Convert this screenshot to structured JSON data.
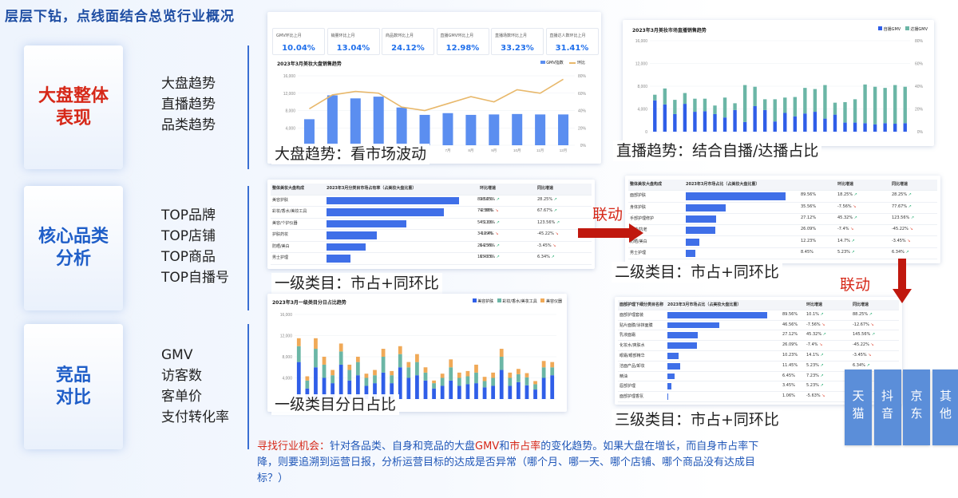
{
  "title": "层层下钻，点线面结合总览行业概况",
  "sections": [
    {
      "name": "大盘整体\n表现",
      "color": "#d62818",
      "items": [
        "大盘趋势",
        "直播趋势",
        "品类趋势"
      ]
    },
    {
      "name": "核心品类\n分析",
      "color": "#1f5ec8",
      "items": [
        "TOP品牌",
        "TOP店铺",
        "TOP商品",
        "TOP自播号"
      ]
    },
    {
      "name": "竞品\n对比",
      "color": "#1f5ec8",
      "items": [
        "GMV",
        "访客数",
        "客单价",
        "支付转化率"
      ]
    }
  ],
  "kpis": [
    {
      "label": "GMV环比上月",
      "value": "10.04%"
    },
    {
      "label": "销量环比上月",
      "value": "13.04%"
    },
    {
      "label": "商品数环比上月",
      "value": "24.12%"
    },
    {
      "label": "直播GMV环比上月",
      "value": "12.98%"
    },
    {
      "label": "直播场数环比上月",
      "value": "33.23%"
    },
    {
      "label": "直播达人数环比上月",
      "value": "31.41%"
    }
  ],
  "panel1": {
    "title": "2023年3月美妆大盘销售趋势",
    "legend": [
      "GMV指数",
      "环比"
    ],
    "caption": "大盘趋势：看市场波动",
    "chart_data": {
      "type": "bar",
      "categories": [
        "1月",
        "2月",
        "3月",
        "4月",
        "5月",
        "6月",
        "7月",
        "8月",
        "9月",
        "10月",
        "11月",
        "12月"
      ],
      "series": [
        {
          "name": "GMV指数",
          "values": [
            6000,
            11500,
            10800,
            11200,
            8700,
            7000,
            7400,
            7000,
            7100,
            7200,
            7100,
            7100
          ]
        },
        {
          "name": "环比",
          "values": [
            42,
            58,
            62,
            60,
            44,
            40,
            48,
            56,
            50,
            64,
            60,
            76
          ]
        }
      ],
      "ylim": [
        0,
        16000
      ],
      "y2lim": [
        0,
        80
      ],
      "yticks": [
        "16,000",
        "12,000",
        "8,000",
        "4,000",
        "0"
      ],
      "y2ticks": [
        "80%",
        "60%",
        "40%",
        "20%",
        "0%"
      ]
    }
  },
  "panel2": {
    "title": "2023年3月美妆市场直播销售趋势",
    "legend": [
      "自播GMV",
      "达播GMV"
    ],
    "caption": "直播趋势：结合自播/达播占比",
    "chart_data": {
      "type": "bar",
      "series": [
        {
          "name": "自播GMV",
          "values": [
            5500,
            4800,
            3100,
            4900,
            3500,
            3600,
            3100,
            2500,
            3800,
            1700,
            4500,
            3800,
            1800,
            3300,
            2700,
            3200,
            3500,
            2300,
            3000,
            1600,
            1600,
            1500,
            1300,
            1500,
            1400,
            1500
          ]
        },
        {
          "name": "达播GMV",
          "values": [
            1000,
            2800,
            2500,
            1900,
            2300,
            2200,
            1500,
            3500,
            1200,
            6500,
            3400,
            1900,
            3900,
            2700,
            3400,
            4500,
            4000,
            5900,
            2100,
            3600,
            4100,
            6800,
            6600,
            6200,
            6800,
            6400
          ]
        }
      ],
      "ylim": [
        0,
        16000
      ],
      "yticks": [
        "16,000",
        "12,000",
        "8,000",
        "4,000",
        "0"
      ],
      "y2ticks": [
        "80%",
        "60%",
        "40%",
        "20%",
        "0%"
      ]
    }
  },
  "table1": {
    "headers": [
      "整体美妆大盘构成",
      "2023年3月分类目市场占有率（占美妆大盘比重）",
      "环比增速",
      "同比增速"
    ],
    "caption": "一级类目：市占+同环比",
    "rows": [
      {
        "name": "美容护肤",
        "share": "89.56%",
        "pct": 89.56,
        "mom": "28.25%",
        "mom_up": true,
        "yoy": "28.25%",
        "yoy_up": true
      },
      {
        "name": "彩妆/香水/美妆工具",
        "share": "79.56%",
        "pct": 79.56,
        "mom": "-2.56%",
        "mom_up": false,
        "yoy": "67.67%",
        "yoy_up": true
      },
      {
        "name": "美容/个护仪器",
        "share": "54.12%",
        "pct": 54.12,
        "mom": "45.32%",
        "mom_up": true,
        "yoy": "123.56%",
        "yoy_up": true
      },
      {
        "name": "护肤药妆",
        "share": "34.09%",
        "pct": 34.09,
        "mom": "-12.4%",
        "mom_up": false,
        "yoy": "-45.22%",
        "yoy_up": false
      },
      {
        "name": "防晒/美白",
        "share": "26.23%",
        "pct": 26.23,
        "mom": "14.56%",
        "mom_up": true,
        "yoy": "-3.45%",
        "yoy_up": false
      },
      {
        "name": "男士护理",
        "share": "16.45%",
        "pct": 16.45,
        "mom": "15.23%",
        "mom_up": true,
        "yoy": "6.34%",
        "yoy_up": true
      }
    ]
  },
  "table2": {
    "headers": [
      "整体美妆大盘构成",
      "2023年3月市场占比（占美妆大盘比重）",
      "环比增速",
      "同比增速"
    ],
    "caption": "二级类目：市占+同环比",
    "rows": [
      {
        "name": "面部护肤",
        "share": "89.56%",
        "pct": 89.56,
        "mom": "18.25%",
        "mom_up": true,
        "yoy": "28.25%",
        "yoy_up": true
      },
      {
        "name": "身体护肤",
        "share": "35.56%",
        "pct": 35.56,
        "mom": "-7.56%",
        "mom_up": false,
        "yoy": "77.67%",
        "yoy_up": true
      },
      {
        "name": "手部护理修护",
        "share": "27.12%",
        "pct": 27.12,
        "mom": "45.32%",
        "mom_up": true,
        "yoy": "123.56%",
        "yoy_up": true
      },
      {
        "name": "抗敏/抗老",
        "share": "26.09%",
        "pct": 26.09,
        "mom": "-7.4%",
        "mom_up": false,
        "yoy": "-45.22%",
        "yoy_up": false
      },
      {
        "name": "防晒/美白",
        "share": "12.23%",
        "pct": 12.23,
        "mom": "14.7%",
        "mom_up": true,
        "yoy": "-3.45%",
        "yoy_up": false
      },
      {
        "name": "男士护理",
        "share": "8.45%",
        "pct": 8.45,
        "mom": "5.23%",
        "mom_up": true,
        "yoy": "6.34%",
        "yoy_up": true
      }
    ]
  },
  "table3": {
    "headers": [
      "面部护理下细分类目名称",
      "2023年3月市场占比（占美妆大盘比重）",
      "环比增速",
      "同比增速"
    ],
    "caption": "三级类目：市占+同环比",
    "rows": [
      {
        "name": "面部护理套装",
        "share": "89.56%",
        "pct": 89.56,
        "mom": "10.1%",
        "mom_up": true,
        "yoy": "88.25%",
        "yoy_up": true
      },
      {
        "name": "贴片面膜/涂抹面膜",
        "share": "46.56%",
        "pct": 46.56,
        "mom": "-7.56%",
        "mom_up": false,
        "yoy": "-12.67%",
        "yoy_up": false
      },
      {
        "name": "乳液面霜",
        "share": "27.12%",
        "pct": 27.12,
        "mom": "45.32%",
        "mom_up": true,
        "yoy": "145.56%",
        "yoy_up": true
      },
      {
        "name": "化妆水/爽肤水",
        "share": "26.09%",
        "pct": 26.09,
        "mom": "-7.4%",
        "mom_up": false,
        "yoy": "-45.22%",
        "yoy_up": false
      },
      {
        "name": "眼霜/眼部精华",
        "share": "10.23%",
        "pct": 10.23,
        "mom": "14.1%",
        "mom_up": true,
        "yoy": "-3.45%",
        "yoy_up": false
      },
      {
        "name": "洁面产品/卸妆",
        "share": "11.45%",
        "pct": 11.45,
        "mom": "5.23%",
        "mom_up": true,
        "yoy": "6.34%",
        "yoy_up": true
      },
      {
        "name": "精油",
        "share": "6.45%",
        "pct": 6.45,
        "mom": "7.23%",
        "mom_up": true,
        "yoy": "",
        "yoy_up": true
      },
      {
        "name": "唇部护理",
        "share": "3.45%",
        "pct": 3.45,
        "mom": "5.23%",
        "mom_up": true,
        "yoy": "",
        "yoy_up": true
      },
      {
        "name": "面部护理香氛",
        "share": "1.06%",
        "pct": 1.06,
        "mom": "-5.63%",
        "mom_up": false,
        "yoy": "",
        "yoy_up": true
      }
    ]
  },
  "panel_daily": {
    "title": "2023年3月一级类目分日占比趋势",
    "legend": [
      "美容护肤",
      "彩妆/香水/美妆工具",
      "美容仪器"
    ],
    "caption": "一级类目分日占比",
    "colors": [
      "#2f5ee8",
      "#6bb6a6",
      "#f0a957"
    ],
    "chart_data": {
      "type": "bar",
      "series": [
        {
          "name": "美容护肤",
          "values": [
            7000,
            2000,
            6000,
            4000,
            3000,
            6500,
            3500,
            4500,
            2500,
            3000,
            5000,
            3000,
            6000,
            4000,
            4500,
            3500,
            2000,
            2500,
            3500,
            2500,
            2800,
            3000,
            2200,
            2500,
            5500,
            2500,
            3200,
            2600,
            1800,
            4000,
            4500
          ]
        },
        {
          "name": "彩妆/香水/美妆工具",
          "values": [
            3000,
            1500,
            3500,
            2500,
            1500,
            2500,
            2000,
            2500,
            1500,
            1500,
            3000,
            1500,
            2500,
            2000,
            2500,
            1500,
            1000,
            1500,
            2500,
            1500,
            1500,
            2000,
            1200,
            1500,
            2500,
            1500,
            1500,
            1500,
            1000,
            2000,
            1500
          ]
        },
        {
          "name": "美容仪器",
          "values": [
            1500,
            800,
            2000,
            1500,
            1000,
            1500,
            1000,
            1000,
            800,
            1000,
            1500,
            800,
            1500,
            1000,
            1500,
            1000,
            500,
            800,
            1500,
            1000,
            1000,
            1500,
            800,
            1000,
            1500,
            1000,
            1000,
            800,
            600,
            1200,
            1000
          ]
        }
      ],
      "ylim": [
        0,
        16000
      ],
      "yticks": [
        "16,000",
        "12,000",
        "8,000",
        "4,000",
        "0"
      ]
    }
  },
  "links": [
    "联动",
    "联动"
  ],
  "platforms": [
    "天猫",
    "抖音",
    "京东",
    "其他"
  ],
  "note": {
    "label": "寻找行业机会：",
    "p1": "针对各品类、自身和竞品的大盘",
    "gmv": "GMV",
    "p2": "和",
    "share": "市占率",
    "p3": "的变化趋势。如果大盘在增长，而自身市占率下降，则要追溯到运营日报，分析运营目标的达成是否异常（哪个月、哪一天、哪个店铺、哪个商品没有达成目标？）"
  }
}
